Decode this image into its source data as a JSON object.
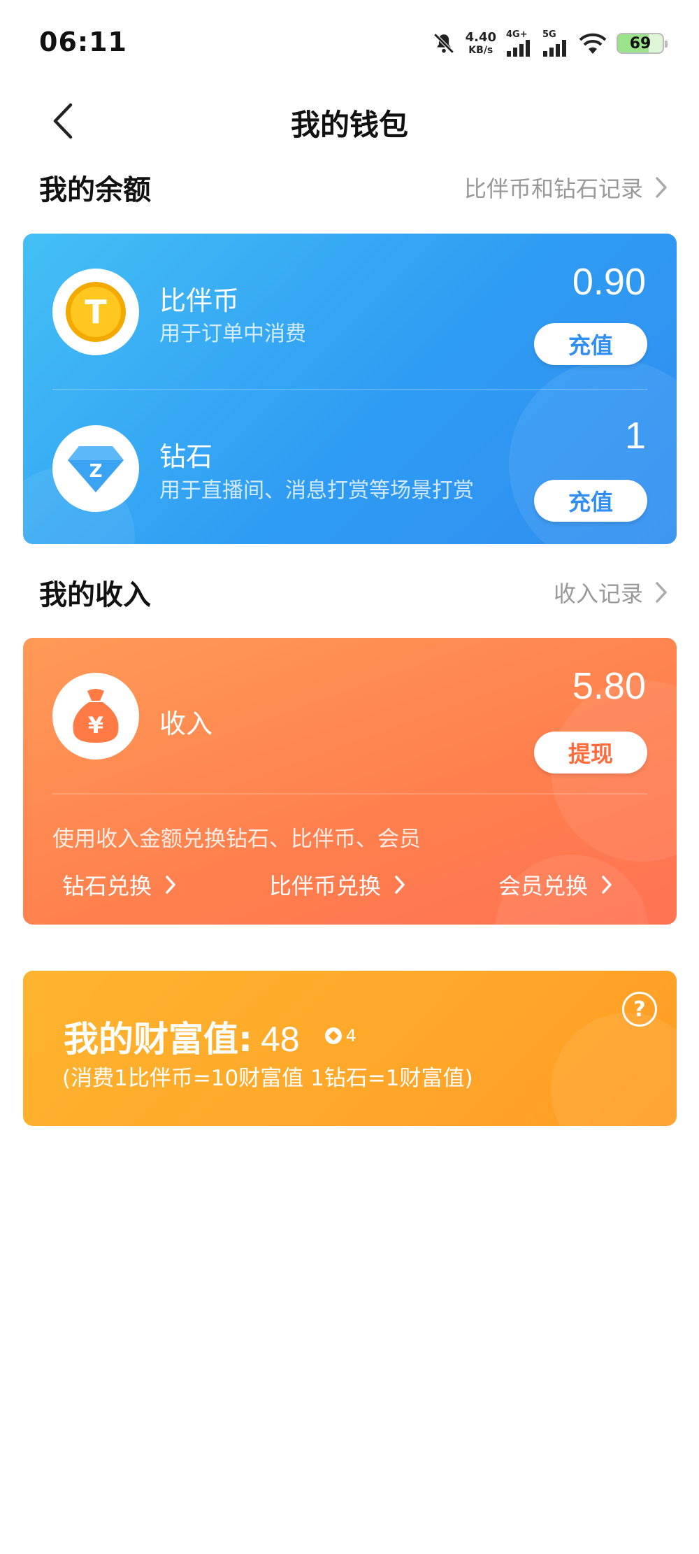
{
  "status_bar": {
    "time": "06:11",
    "net_speed_value": "4.40",
    "net_speed_unit": "KB/s",
    "sim1_label": "4G+",
    "sim2_label": "5G",
    "battery": "69"
  },
  "header": {
    "title": "我的钱包"
  },
  "balance": {
    "section_title": "我的余额",
    "records_link": "比伴币和钻石记录",
    "coin": {
      "name": "比伴币",
      "desc": "用于订单中消费",
      "amount": "0.90",
      "button": "充值",
      "icon_letter": "T"
    },
    "diamond": {
      "name": "钻石",
      "desc": "用于直播间、消息打赏等场景打赏",
      "amount": "1",
      "button": "充值",
      "icon_letter": "Z"
    }
  },
  "income": {
    "section_title": "我的收入",
    "records_link": "收入记录",
    "name": "收入",
    "amount": "5.80",
    "button": "提现",
    "icon_letter": "¥",
    "exchange_desc": "使用收入金额兑换钻石、比伴币、会员",
    "exchanges": [
      "钻石兑换",
      "比伴币兑换",
      "会员兑换"
    ]
  },
  "wealth": {
    "label": "我的财富值:",
    "value": "48",
    "level": "4",
    "note": "(消费1比伴币=10财富值 1钻石=1财富值)",
    "help": "?"
  },
  "colors": {
    "balance_card": "#2f9cf3",
    "income_card": "#ff7f4e",
    "wealth_card": "#ffa52a"
  }
}
